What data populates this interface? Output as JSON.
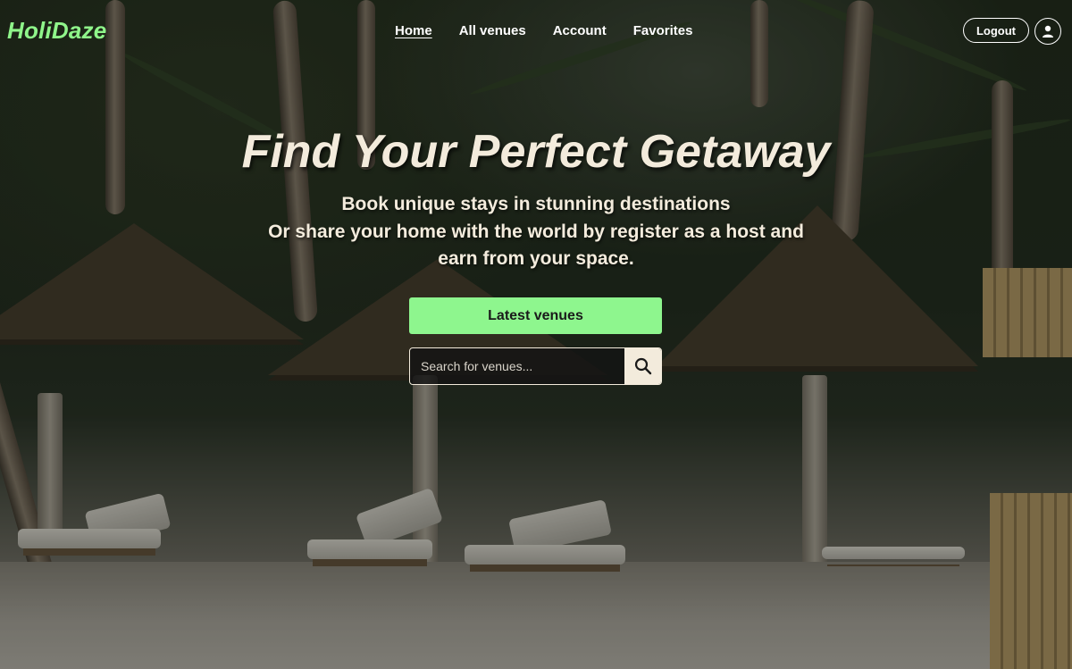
{
  "brand": {
    "name": "HoliDaze",
    "color": "#8ff58a"
  },
  "nav": {
    "items": [
      {
        "label": "Home",
        "active": true
      },
      {
        "label": "All venues",
        "active": false
      },
      {
        "label": "Account",
        "active": false
      },
      {
        "label": "Favorites",
        "active": false
      }
    ],
    "logout_label": "Logout",
    "profile_icon": "user-icon"
  },
  "hero": {
    "title": "Find Your Perfect Getaway",
    "subtitle_lines": [
      "Book unique stays in stunning destinations",
      "Or share your home with the world by register as a host and",
      "earn from your space."
    ],
    "cta_label": "Latest venues",
    "cta_color": "#8ef68e"
  },
  "search": {
    "placeholder": "Search for venues...",
    "value": "",
    "icon": "search-icon"
  }
}
